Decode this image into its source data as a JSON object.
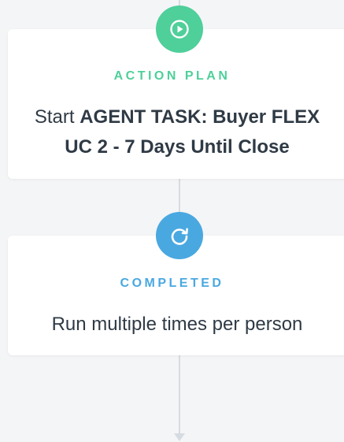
{
  "steps": [
    {
      "icon": "play-icon",
      "tag": "ACTION PLAN",
      "text_prefix": "Start ",
      "text_bold_1": "AGENT TASK: Buyer FLEX",
      "text_bold_2": "UC 2 - 7 Days Until Close",
      "accent": "#4fcf9a"
    },
    {
      "icon": "refresh-icon",
      "tag": "COMPLETED",
      "text": "Run multiple times per person",
      "accent": "#4aa8e0"
    }
  ]
}
